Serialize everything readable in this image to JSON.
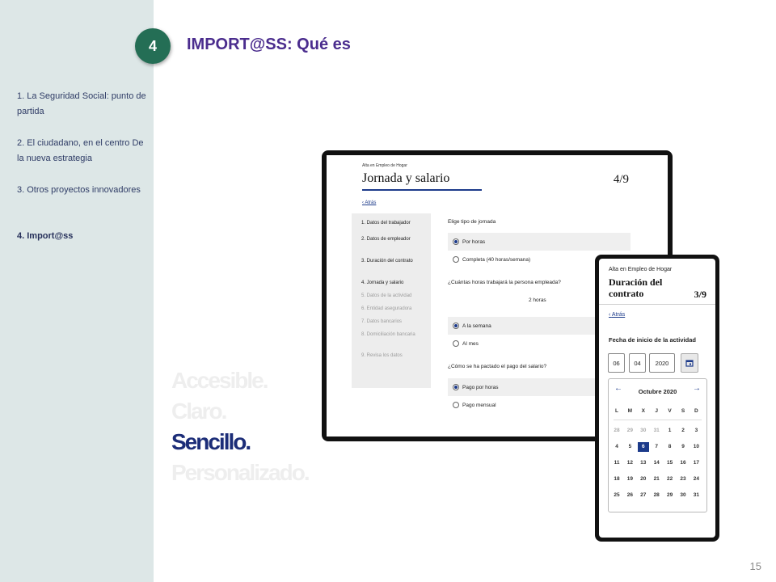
{
  "slide": {
    "section_number": "4",
    "title": "IMPORT@SS: Qué es",
    "page_number": "15"
  },
  "sidebar": {
    "items": [
      {
        "label": "1. La Seguridad Social: punto de partida",
        "active": false
      },
      {
        "label": "2. El ciudadano, en el centro De la nueva estrategia",
        "active": false
      },
      {
        "label": "3. Otros proyectos innovadores",
        "active": false
      },
      {
        "label": "4. Import@ss",
        "active": true
      }
    ]
  },
  "taglines": [
    "Accesible.",
    "Claro.",
    "Sencillo.",
    "Personalizado."
  ],
  "tablet": {
    "kicker": "Alta en Empleo de Hogar",
    "title": "Jornada y salario",
    "step": "4/9",
    "back": "Atrás",
    "steps": [
      {
        "label": "1. Datos del trabajador"
      },
      {
        "label": "2. Datos de empleador"
      },
      {
        "label": "3. Duración del contrato"
      },
      {
        "label": "4. Jornada y salario"
      },
      {
        "label": "5. Datos de la actividad"
      },
      {
        "label": "6. Entidad aseguradora"
      },
      {
        "label": "7. Datos bancarios"
      },
      {
        "label": "8. Domiciliación bancaria"
      },
      {
        "label": "9. Revisa los datos"
      }
    ],
    "questions": {
      "jornada": "Elige tipo de jornada",
      "jornada_options": [
        "Por horas",
        "Completa (40 horas/semana)"
      ],
      "horas": "¿Cuántas horas trabajará la persona empleada?",
      "horas_value": "2 horas",
      "horas_options": [
        "A la semana",
        "Al mes"
      ],
      "pago": "¿Cómo se ha pactado el pago del salario?",
      "pago_options": [
        "Pago por horas",
        "Pago mensual"
      ]
    }
  },
  "phone": {
    "kicker": "Alta en Empleo de Hogar",
    "title": "Duración del contrato",
    "step": "3/9",
    "back": "Atrás",
    "date_label": "Fecha de inicio de la actividad",
    "date": {
      "day": "06",
      "month": "04",
      "year": "2020"
    },
    "calendar": {
      "month": "Octubre 2020",
      "weekdays": [
        "L",
        "M",
        "X",
        "J",
        "V",
        "S",
        "D"
      ],
      "selected_day": "6",
      "weeks": [
        [
          "28",
          "29",
          "30",
          "31",
          "1",
          "2",
          "3"
        ],
        [
          "4",
          "5",
          "6",
          "7",
          "8",
          "9",
          "10"
        ],
        [
          "11",
          "12",
          "13",
          "14",
          "15",
          "16",
          "17"
        ],
        [
          "18",
          "19",
          "20",
          "21",
          "22",
          "23",
          "24"
        ],
        [
          "25",
          "26",
          "27",
          "28",
          "29",
          "30",
          "31"
        ]
      ]
    }
  },
  "icons": {
    "back": "chevron-left-icon",
    "calendar": "calendar-icon",
    "prev_month": "arrow-left-icon",
    "next_month": "arrow-right-icon"
  },
  "colors": {
    "sidebar": "#dde7e7",
    "badge": "#246e55",
    "title": "#4b2d8e",
    "accent": "#1c3a8a",
    "tagline_active": "#1c2d78",
    "tagline_inactive": "#eeeeee"
  }
}
